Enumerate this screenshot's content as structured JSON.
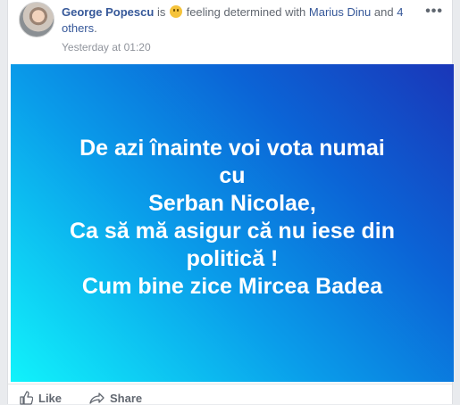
{
  "post": {
    "author": "George Popescu",
    "is_text": "is",
    "feeling_icon": "determined-face-icon",
    "feeling_text": "feeling determined with",
    "tagged_user": "Marius Dinu",
    "and_text": "and",
    "others_text": "4 others",
    "period": ".",
    "timestamp": "Yesterday at 01:20",
    "more_label": "•••"
  },
  "image_text": {
    "lines": [
      "De azi înainte voi vota numai",
      "cu",
      "Serban Nicolae,",
      "Ca să mă asigur că nu iese din",
      "politică !",
      "Cum bine zice Mircea Badea"
    ]
  },
  "actions": {
    "like_label": "Like",
    "share_label": "Share"
  },
  "colors": {
    "link": "#365899",
    "meta": "#90949c",
    "gradient_start": "#11f3fb",
    "gradient_end": "#1a36b8"
  }
}
